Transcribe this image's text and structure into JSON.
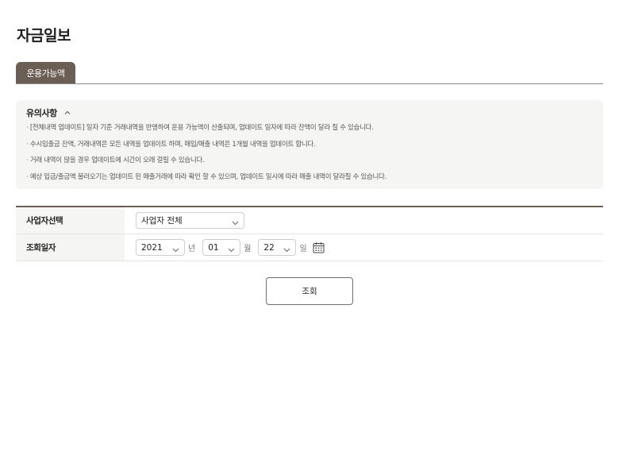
{
  "page": {
    "title": "자금일보"
  },
  "tabs": [
    {
      "label": "운용가능액",
      "active": true
    }
  ],
  "notice": {
    "title": "유의사항",
    "items": [
      "[전체내역 업데이트] 일자 기준 거래내역을 반영하여 운용 가능액이 산출되며, 업데이트 일자에 따라 잔액이 달라 질 수 있습니다.",
      "수시입출금 잔액, 거래내역은 모든 내역을 업데이트 하며, 매입/매출 내역은 1개월 내역을 업데이트 합니다.",
      "거래 내역이 많을 경우 업데이트에 시간이 오래 걸릴 수 있습니다.",
      "예상 입금/출금액 불러오기는 업데이트 된 매출거래에 따라 확인 할 수 있으며, 업데이트 일시에 따라 매출 내역이 달라질 수 있습니다."
    ]
  },
  "form": {
    "business": {
      "label": "사업자선택",
      "value": "사업자 전체"
    },
    "date": {
      "label": "조회일자",
      "year": "2021",
      "year_unit": "년",
      "month": "01",
      "month_unit": "월",
      "day": "22",
      "day_unit": "일"
    }
  },
  "search_button": {
    "label": "조회"
  },
  "colors": {
    "accent": "#6b5e54",
    "panel": "#f5f5f3"
  },
  "icons": {
    "collapse": "chevron-up-icon",
    "dropdown": "chevron-down-icon",
    "calendar": "calendar-icon"
  }
}
